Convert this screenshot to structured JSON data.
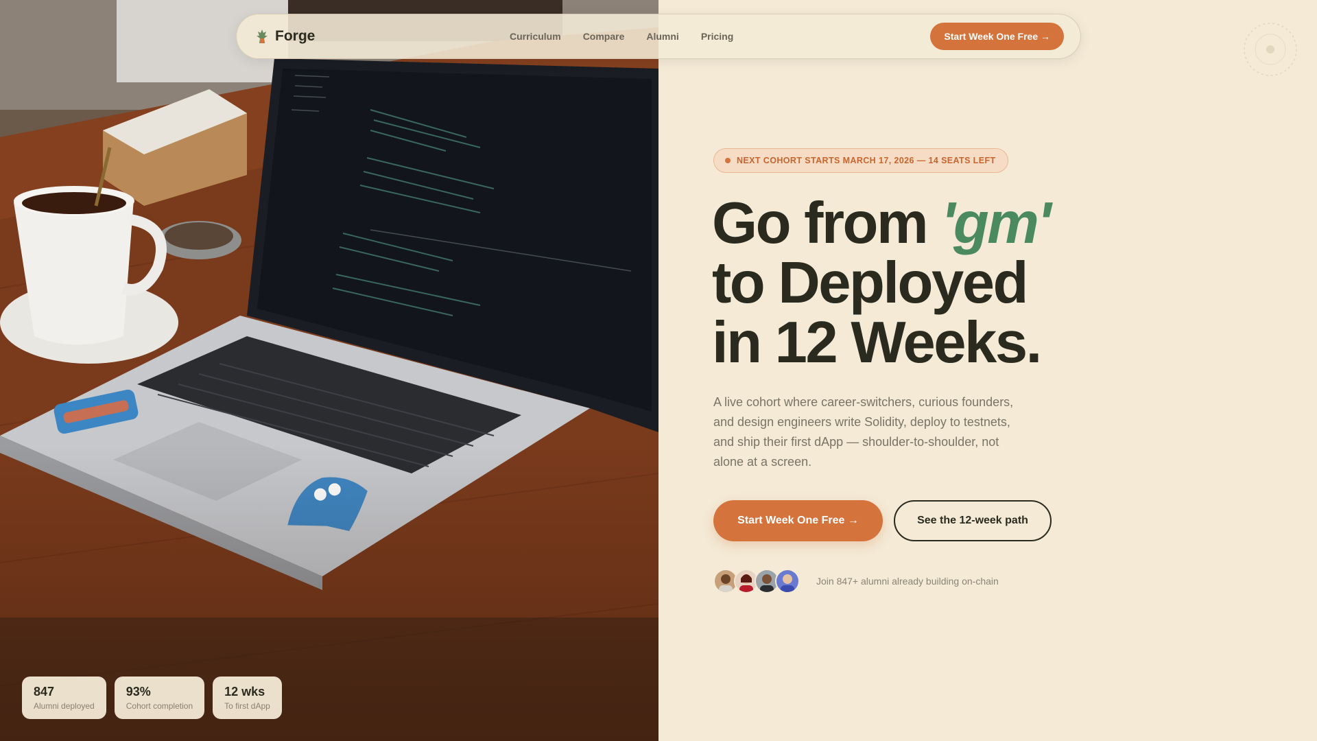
{
  "nav": {
    "brand": "Forge",
    "links": [
      "Curriculum",
      "Compare",
      "Alumni",
      "Pricing"
    ],
    "cta": "Start Week One Free →"
  },
  "hero": {
    "badge": "NEXT COHORT STARTS MARCH 17, 2026 — 14 SEATS LEFT",
    "headline_pre": "Go from ",
    "headline_accent": "'gm'",
    "headline_line2": "to Deployed",
    "headline_line3": "in 12 Weeks.",
    "lede": "A live cohort where career-switchers, curious founders, and design engineers write Solidity, deploy to testnets, and ship their first dApp — shoulder-to-shoulder, not alone at a screen.",
    "primary_cta": "Start Week One Free →",
    "secondary_cta": "See the 12-week path",
    "proof_text": "Join 847+ alumni already building on-chain"
  },
  "stats": [
    {
      "value": "847",
      "label": "Alumni deployed"
    },
    {
      "value": "93%",
      "label": "Cohort completion"
    },
    {
      "value": "12 wks",
      "label": "To first dApp"
    }
  ],
  "colors": {
    "background": "#f4ead6",
    "accent": "#d4733b",
    "accent_green": "#4a8a5e",
    "ink": "#2a2a1f"
  },
  "icons": [
    "forge-logo-icon",
    "arrow-right-icon",
    "decorative-circle-icon"
  ]
}
